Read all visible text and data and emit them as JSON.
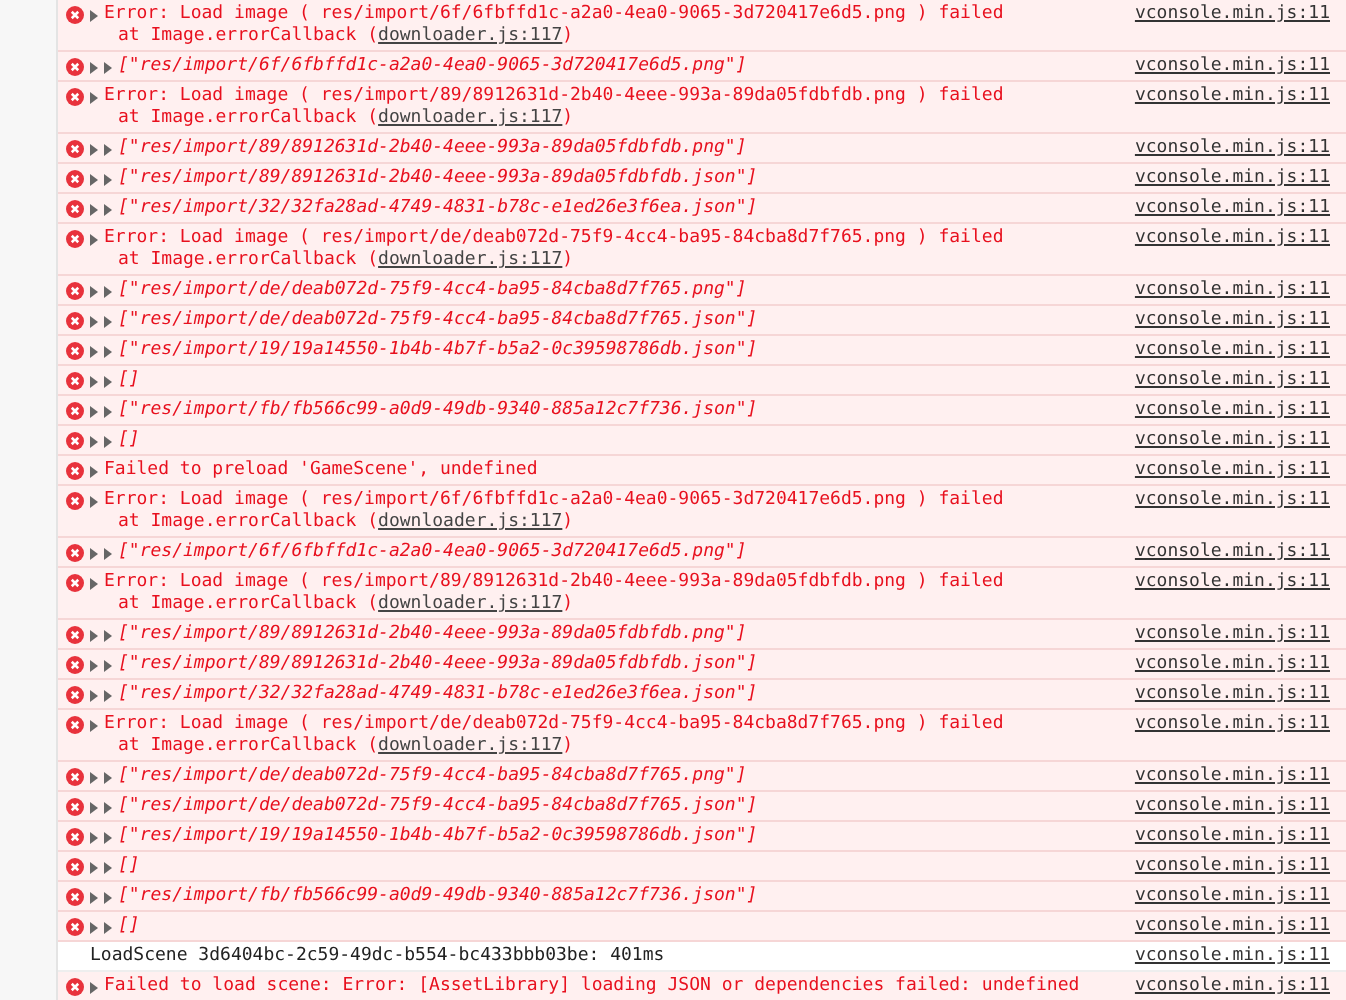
{
  "console": {
    "entries": [
      {
        "kind": "error",
        "message": "Error: Load image ( res/import/6f/6fbffd1c-a2a0-4ea0-9065-3d720417e6d5.png ) failed",
        "stack": {
          "prefix": "at Image.errorCallback (",
          "link": "downloader.js:117",
          "suffix": ")"
        },
        "source": "vconsole.min.js:11"
      },
      {
        "kind": "array",
        "message": "[\"res/import/6f/6fbffd1c-a2a0-4ea0-9065-3d720417e6d5.png\"]",
        "source": "vconsole.min.js:11"
      },
      {
        "kind": "error",
        "message": "Error: Load image ( res/import/89/8912631d-2b40-4eee-993a-89da05fdbfdb.png ) failed",
        "stack": {
          "prefix": "at Image.errorCallback (",
          "link": "downloader.js:117",
          "suffix": ")"
        },
        "source": "vconsole.min.js:11"
      },
      {
        "kind": "array",
        "message": "[\"res/import/89/8912631d-2b40-4eee-993a-89da05fdbfdb.png\"]",
        "source": "vconsole.min.js:11"
      },
      {
        "kind": "array",
        "message": "[\"res/import/89/8912631d-2b40-4eee-993a-89da05fdbfdb.json\"]",
        "source": "vconsole.min.js:11"
      },
      {
        "kind": "array",
        "message": "[\"res/import/32/32fa28ad-4749-4831-b78c-e1ed26e3f6ea.json\"]",
        "source": "vconsole.min.js:11"
      },
      {
        "kind": "error",
        "message": "Error: Load image ( res/import/de/deab072d-75f9-4cc4-ba95-84cba8d7f765.png ) failed",
        "stack": {
          "prefix": "at Image.errorCallback (",
          "link": "downloader.js:117",
          "suffix": ")"
        },
        "source": "vconsole.min.js:11"
      },
      {
        "kind": "array",
        "message": "[\"res/import/de/deab072d-75f9-4cc4-ba95-84cba8d7f765.png\"]",
        "source": "vconsole.min.js:11"
      },
      {
        "kind": "array",
        "message": "[\"res/import/de/deab072d-75f9-4cc4-ba95-84cba8d7f765.json\"]",
        "source": "vconsole.min.js:11"
      },
      {
        "kind": "array",
        "message": "[\"res/import/19/19a14550-1b4b-4b7f-b5a2-0c39598786db.json\"]",
        "source": "vconsole.min.js:11"
      },
      {
        "kind": "array",
        "message": "[]",
        "source": "vconsole.min.js:11"
      },
      {
        "kind": "array",
        "message": "[\"res/import/fb/fb566c99-a0d9-49db-9340-885a12c7f736.json\"]",
        "source": "vconsole.min.js:11"
      },
      {
        "kind": "array",
        "message": "[]",
        "source": "vconsole.min.js:11"
      },
      {
        "kind": "error",
        "message": "Failed to preload 'GameScene', undefined",
        "source": "vconsole.min.js:11"
      },
      {
        "kind": "error",
        "message": "Error: Load image ( res/import/6f/6fbffd1c-a2a0-4ea0-9065-3d720417e6d5.png ) failed",
        "stack": {
          "prefix": "at Image.errorCallback (",
          "link": "downloader.js:117",
          "suffix": ")"
        },
        "source": "vconsole.min.js:11"
      },
      {
        "kind": "array",
        "message": "[\"res/import/6f/6fbffd1c-a2a0-4ea0-9065-3d720417e6d5.png\"]",
        "source": "vconsole.min.js:11"
      },
      {
        "kind": "error",
        "message": "Error: Load image ( res/import/89/8912631d-2b40-4eee-993a-89da05fdbfdb.png ) failed",
        "stack": {
          "prefix": "at Image.errorCallback (",
          "link": "downloader.js:117",
          "suffix": ")"
        },
        "source": "vconsole.min.js:11"
      },
      {
        "kind": "array",
        "message": "[\"res/import/89/8912631d-2b40-4eee-993a-89da05fdbfdb.png\"]",
        "source": "vconsole.min.js:11"
      },
      {
        "kind": "array",
        "message": "[\"res/import/89/8912631d-2b40-4eee-993a-89da05fdbfdb.json\"]",
        "source": "vconsole.min.js:11"
      },
      {
        "kind": "array",
        "message": "[\"res/import/32/32fa28ad-4749-4831-b78c-e1ed26e3f6ea.json\"]",
        "source": "vconsole.min.js:11"
      },
      {
        "kind": "error",
        "message": "Error: Load image ( res/import/de/deab072d-75f9-4cc4-ba95-84cba8d7f765.png ) failed",
        "stack": {
          "prefix": "at Image.errorCallback (",
          "link": "downloader.js:117",
          "suffix": ")"
        },
        "source": "vconsole.min.js:11"
      },
      {
        "kind": "array",
        "message": "[\"res/import/de/deab072d-75f9-4cc4-ba95-84cba8d7f765.png\"]",
        "source": "vconsole.min.js:11"
      },
      {
        "kind": "array",
        "message": "[\"res/import/de/deab072d-75f9-4cc4-ba95-84cba8d7f765.json\"]",
        "source": "vconsole.min.js:11"
      },
      {
        "kind": "array",
        "message": "[\"res/import/19/19a14550-1b4b-4b7f-b5a2-0c39598786db.json\"]",
        "source": "vconsole.min.js:11"
      },
      {
        "kind": "array",
        "message": "[]",
        "source": "vconsole.min.js:11"
      },
      {
        "kind": "array",
        "message": "[\"res/import/fb/fb566c99-a0d9-49db-9340-885a12c7f736.json\"]",
        "source": "vconsole.min.js:11"
      },
      {
        "kind": "array",
        "message": "[]",
        "source": "vconsole.min.js:11"
      },
      {
        "kind": "log",
        "message": "LoadScene 3d6404bc-2c59-49dc-b554-bc433bbb03be: 401ms",
        "source": "vconsole.min.js:11"
      },
      {
        "kind": "error",
        "message": "Failed to load scene: Error: [AssetLibrary] loading JSON or dependencies failed: undefined",
        "source": "vconsole.min.js:11"
      }
    ]
  }
}
